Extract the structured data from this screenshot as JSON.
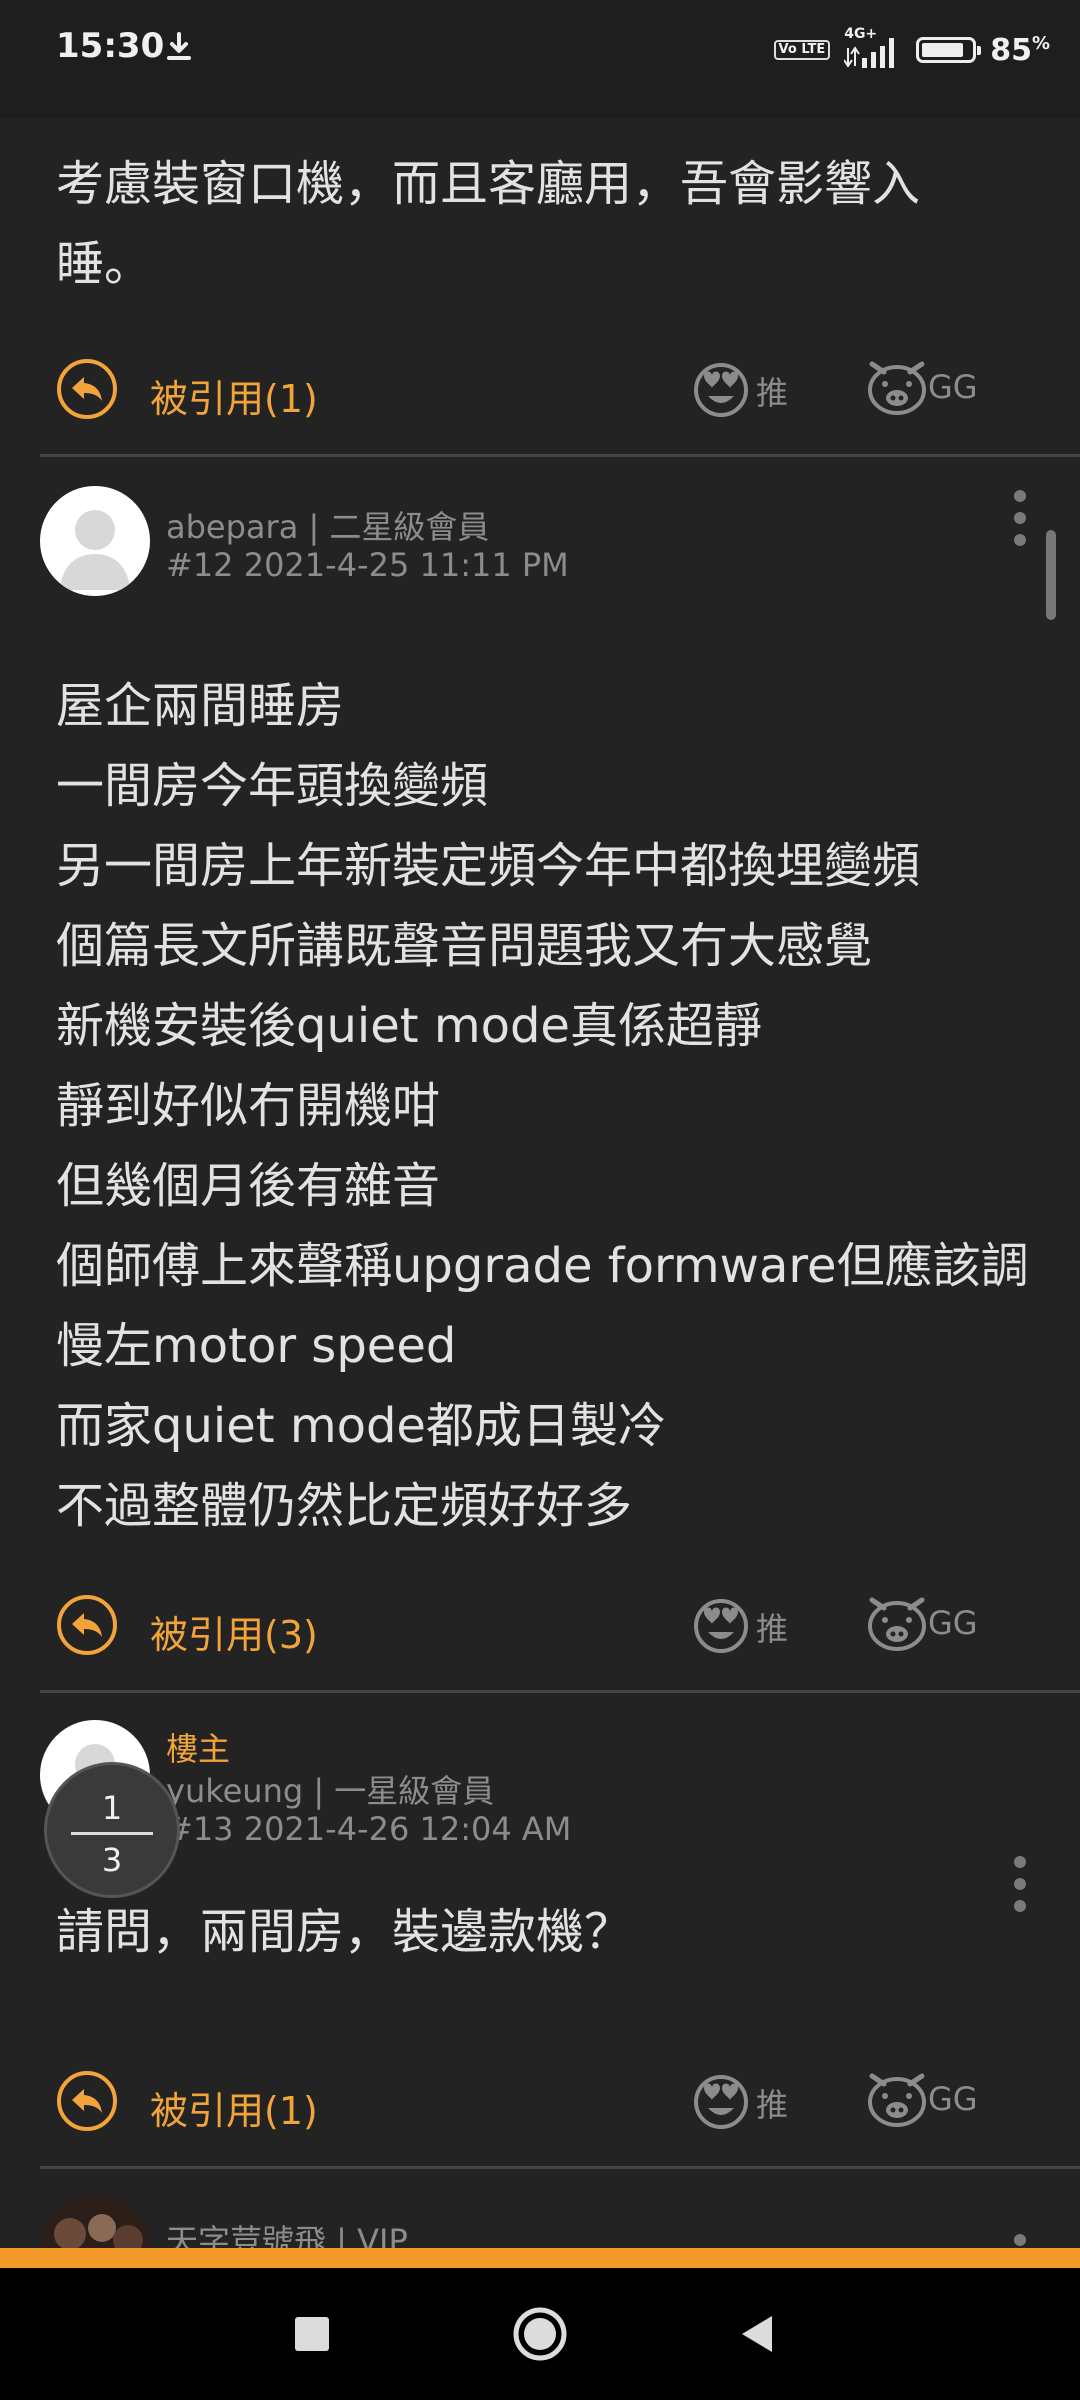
{
  "status_bar": {
    "time": "15:30",
    "volte": "Vo LTE",
    "network": "4G+",
    "battery": "85",
    "battery_unit": "%",
    "battery_level": 0.85
  },
  "partial_post": {
    "text": "考慮裝窗口機，而且客廳用，吾會影響入\n睡。"
  },
  "actions": {
    "quote_label_1": "被引用(1)",
    "quote_label_2": "被引用(3)",
    "quote_label_3": "被引用(1)",
    "like_label": "推",
    "gg_label": "GG"
  },
  "post12": {
    "user": "abepara | 二星級會員",
    "meta": "#12   2021-4-25 11:11 PM",
    "text": "屋企兩間睡房\n一間房今年頭換變頻\n另一間房上年新裝定頻今年中都換埋變頻\n個篇長文所講既聲音問題我又冇大感覺\n新機安裝後quiet mode真係超靜\n靜到好似冇開機咁\n但幾個月後有雜音\n個師傅上來聲稱upgrade formware但應該調\n慢左motor speed\n而家quiet mode都成日製冷\n不過整體仍然比定頻好好多"
  },
  "post13": {
    "op_tag": "樓主",
    "user": "yukeung | 一星級會員",
    "meta": "#13   2021-4-26 12:04 AM",
    "text": "請問，兩間房，裝邊款機？"
  },
  "post14": {
    "user": "天字荳號飛 | VIP"
  },
  "page_indicator": {
    "current": "1",
    "total": "3"
  }
}
